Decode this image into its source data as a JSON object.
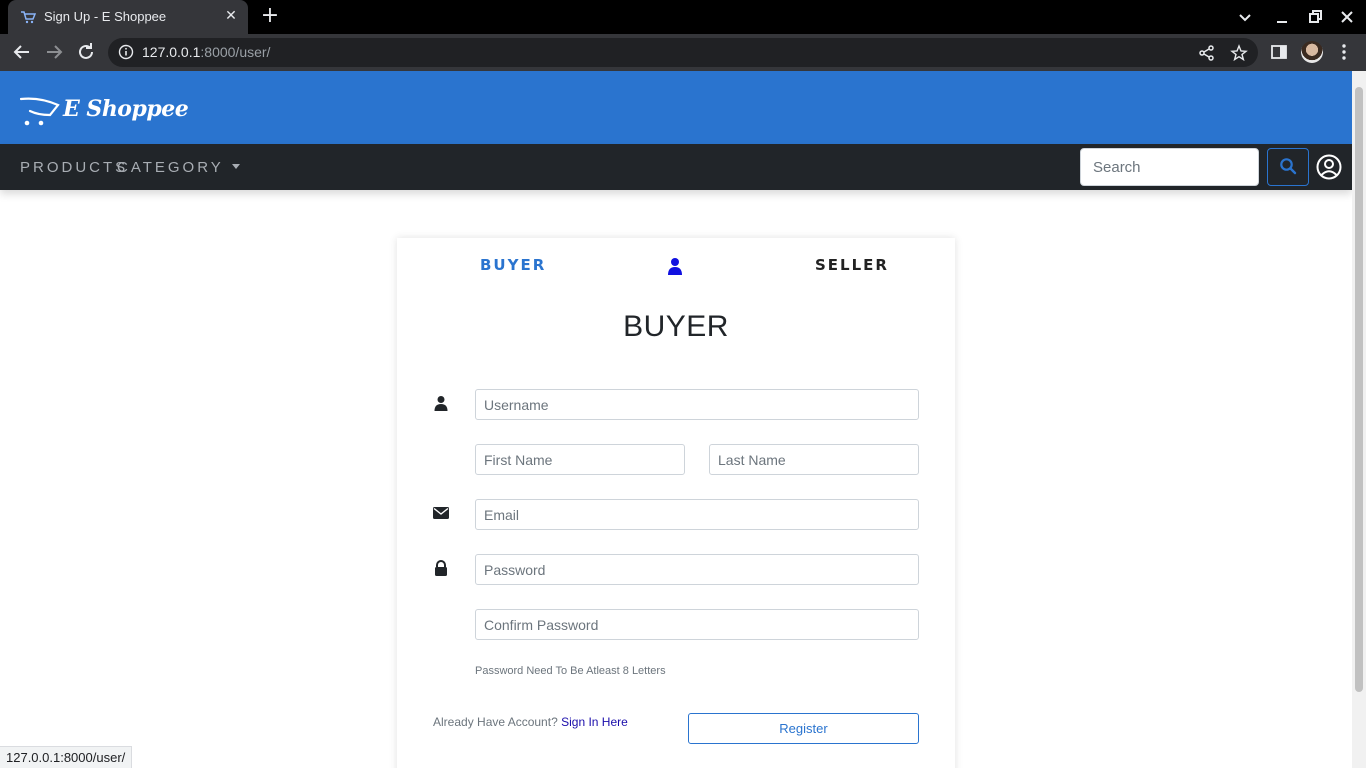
{
  "browser": {
    "tab_title": "Sign Up - E Shoppee",
    "url_host": "127.0.0.1",
    "url_rest": ":8000/user/",
    "status_url": "127.0.0.1:8000/user/"
  },
  "header": {
    "brand": "E Shoppee"
  },
  "nav": {
    "products": "PRODUCTS",
    "category": "CATEGORY",
    "search_placeholder": "Search"
  },
  "signup": {
    "tab_buyer": "BUYER",
    "tab_seller": "SELLER",
    "title": "BUYER",
    "username_placeholder": "Username",
    "first_name_placeholder": "First Name",
    "last_name_placeholder": "Last Name",
    "email_placeholder": "Email",
    "password_placeholder": "Password",
    "confirm_password_placeholder": "Confirm Password",
    "password_hint": "Password Need To Be Atleast 8 Letters",
    "already_text": "Already Have Account?",
    "sign_in_link": "Sign In Here",
    "register_label": "Register"
  },
  "colors": {
    "brand_blue": "#2a74cf",
    "navbar_dark": "#212529"
  }
}
